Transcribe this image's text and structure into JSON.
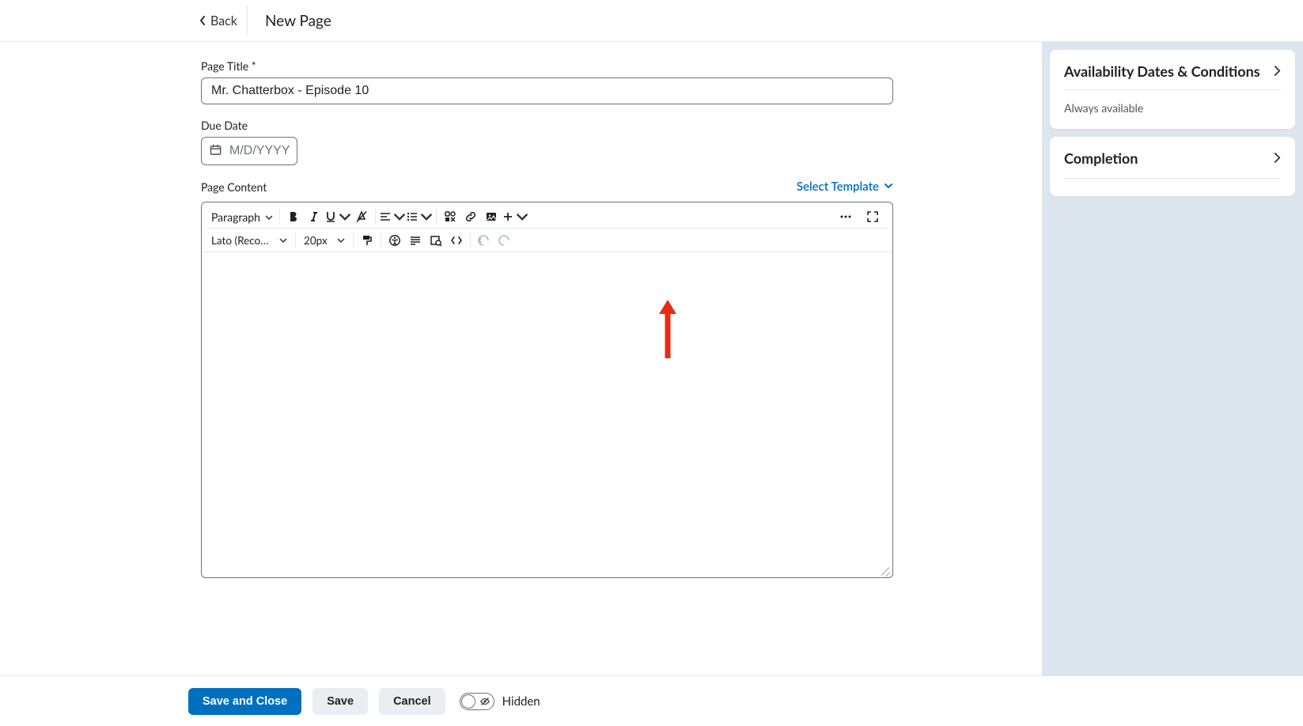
{
  "header": {
    "back_label": "Back",
    "title": "New Page"
  },
  "form": {
    "page_title_label": "Page Title *",
    "page_title_value": "Mr. Chatterbox - Episode 10",
    "due_date_label": "Due Date",
    "due_date_placeholder": "M/D/YYYY",
    "page_content_label": "Page Content",
    "select_template_label": "Select Template"
  },
  "editor": {
    "block_format": "Paragraph",
    "font_family": "Lato (Recomm...",
    "font_size": "20px"
  },
  "side": {
    "availability": {
      "title": "Availability Dates & Conditions",
      "status": "Always available"
    },
    "completion": {
      "title": "Completion"
    }
  },
  "footer": {
    "save_and_close": "Save and Close",
    "save": "Save",
    "cancel": "Cancel",
    "visibility_label": "Hidden"
  }
}
